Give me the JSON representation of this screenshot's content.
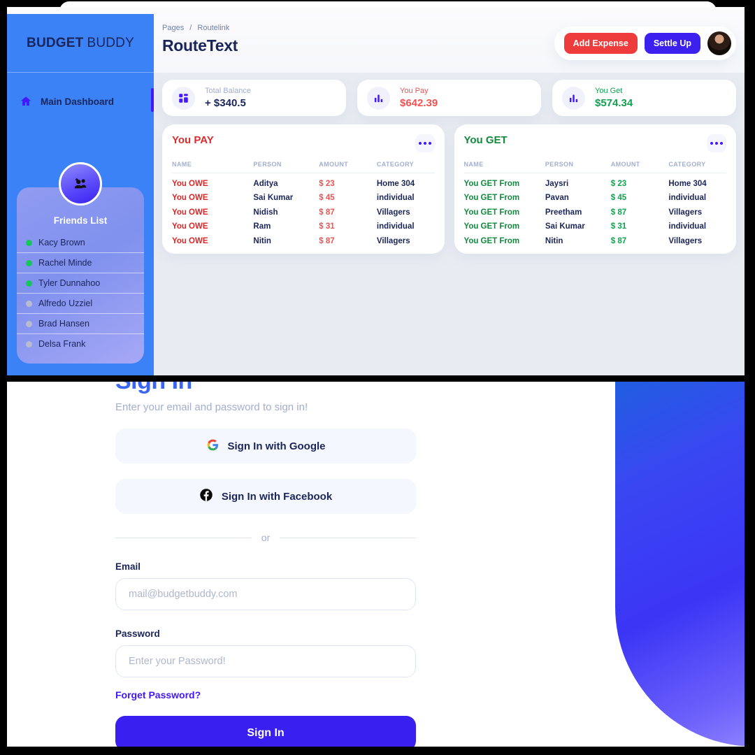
{
  "app": {
    "brand_bold": "BUDGET",
    "brand_light": "BUDDY"
  },
  "sidebar": {
    "nav": [
      {
        "label": "Main Dashboard",
        "icon": "home-icon",
        "active": true
      }
    ],
    "friends": {
      "title": "Friends List",
      "add_icon": "add-friends-icon",
      "items": [
        {
          "name": "Kacy Brown",
          "status": "online"
        },
        {
          "name": "Rachel Minde",
          "status": "online"
        },
        {
          "name": "Tyler Dunnahoo",
          "status": "online"
        },
        {
          "name": "Alfredo Uzziel",
          "status": "offline"
        },
        {
          "name": "Brad Hansen",
          "status": "offline"
        },
        {
          "name": "Delsa Frank",
          "status": "offline"
        }
      ]
    }
  },
  "topbar": {
    "breadcrumb_root": "Pages",
    "breadcrumb_sep": "/",
    "breadcrumb_current": "Routelink",
    "page_title": "RouteText",
    "add_expense_label": "Add Expense",
    "settle_up_label": "Settle Up",
    "avatar_icon": "user-avatar"
  },
  "stats": [
    {
      "label": "Total Balance",
      "value": "+ $340.5",
      "icon": "grid-icon",
      "tone": "neutral"
    },
    {
      "label": "You Pay",
      "value": "$642.39",
      "icon": "chart-icon",
      "tone": "pay"
    },
    {
      "label": "You Get",
      "value": "$574.34",
      "icon": "chart-icon",
      "tone": "get"
    }
  ],
  "tables": {
    "columns": [
      "NAME",
      "PERSON",
      "AMOUNT",
      "CATEGORY"
    ],
    "pay": {
      "title": "You PAY",
      "menu_icon": "more-options-icon",
      "rows": [
        {
          "name": "You OWE",
          "person": "Aditya",
          "amount": "$ 23",
          "category": "Home 304"
        },
        {
          "name": "You OWE",
          "person": "Sai Kumar",
          "amount": "$ 45",
          "category": "individual"
        },
        {
          "name": "You OWE",
          "person": "Nidish",
          "amount": "$ 87",
          "category": "Villagers"
        },
        {
          "name": "You OWE",
          "person": "Ram",
          "amount": "$ 31",
          "category": "individual"
        },
        {
          "name": "You OWE",
          "person": "Nitin",
          "amount": "$ 87",
          "category": "Villagers"
        }
      ]
    },
    "get": {
      "title": "You GET",
      "menu_icon": "more-options-icon",
      "rows": [
        {
          "name": "You GET From",
          "person": "Jaysri",
          "amount": "$ 23",
          "category": "Home 304"
        },
        {
          "name": "You GET From",
          "person": "Pavan",
          "amount": "$ 45",
          "category": "individual"
        },
        {
          "name": "You GET From",
          "person": "Preetham",
          "amount": "$ 87",
          "category": "Villagers"
        },
        {
          "name": "You GET From",
          "person": "Sai Kumar",
          "amount": "$ 31",
          "category": "individual"
        },
        {
          "name": "You GET From",
          "person": "Nitin",
          "amount": "$ 87",
          "category": "Villagers"
        }
      ]
    }
  },
  "signin": {
    "title": "Sign In",
    "subtitle": "Enter your email and password to sign in!",
    "google_label": "Sign In with Google",
    "google_icon": "google-icon",
    "facebook_label": "Sign In with Facebook",
    "facebook_icon": "facebook-icon",
    "divider_text": "or",
    "email_label": "Email",
    "email_placeholder": "mail@budgetbuddy.com",
    "email_value": "",
    "password_label": "Password",
    "password_placeholder": "Enter your Password!",
    "password_value": "",
    "forget_label": "Forget Password?",
    "submit_label": "Sign In"
  },
  "colors": {
    "sidebar": "#3b82f6",
    "accent_purple": "#4318ff",
    "brand_navy": "#1b2559",
    "pay_red": "#e02424",
    "get_green": "#128a3e",
    "signin_blue": "#3965f7",
    "button_blue": "#3a20f0",
    "button_red": "#ee3b3b",
    "online_green": "#15c65b",
    "offline_grey": "#b9bccd"
  }
}
